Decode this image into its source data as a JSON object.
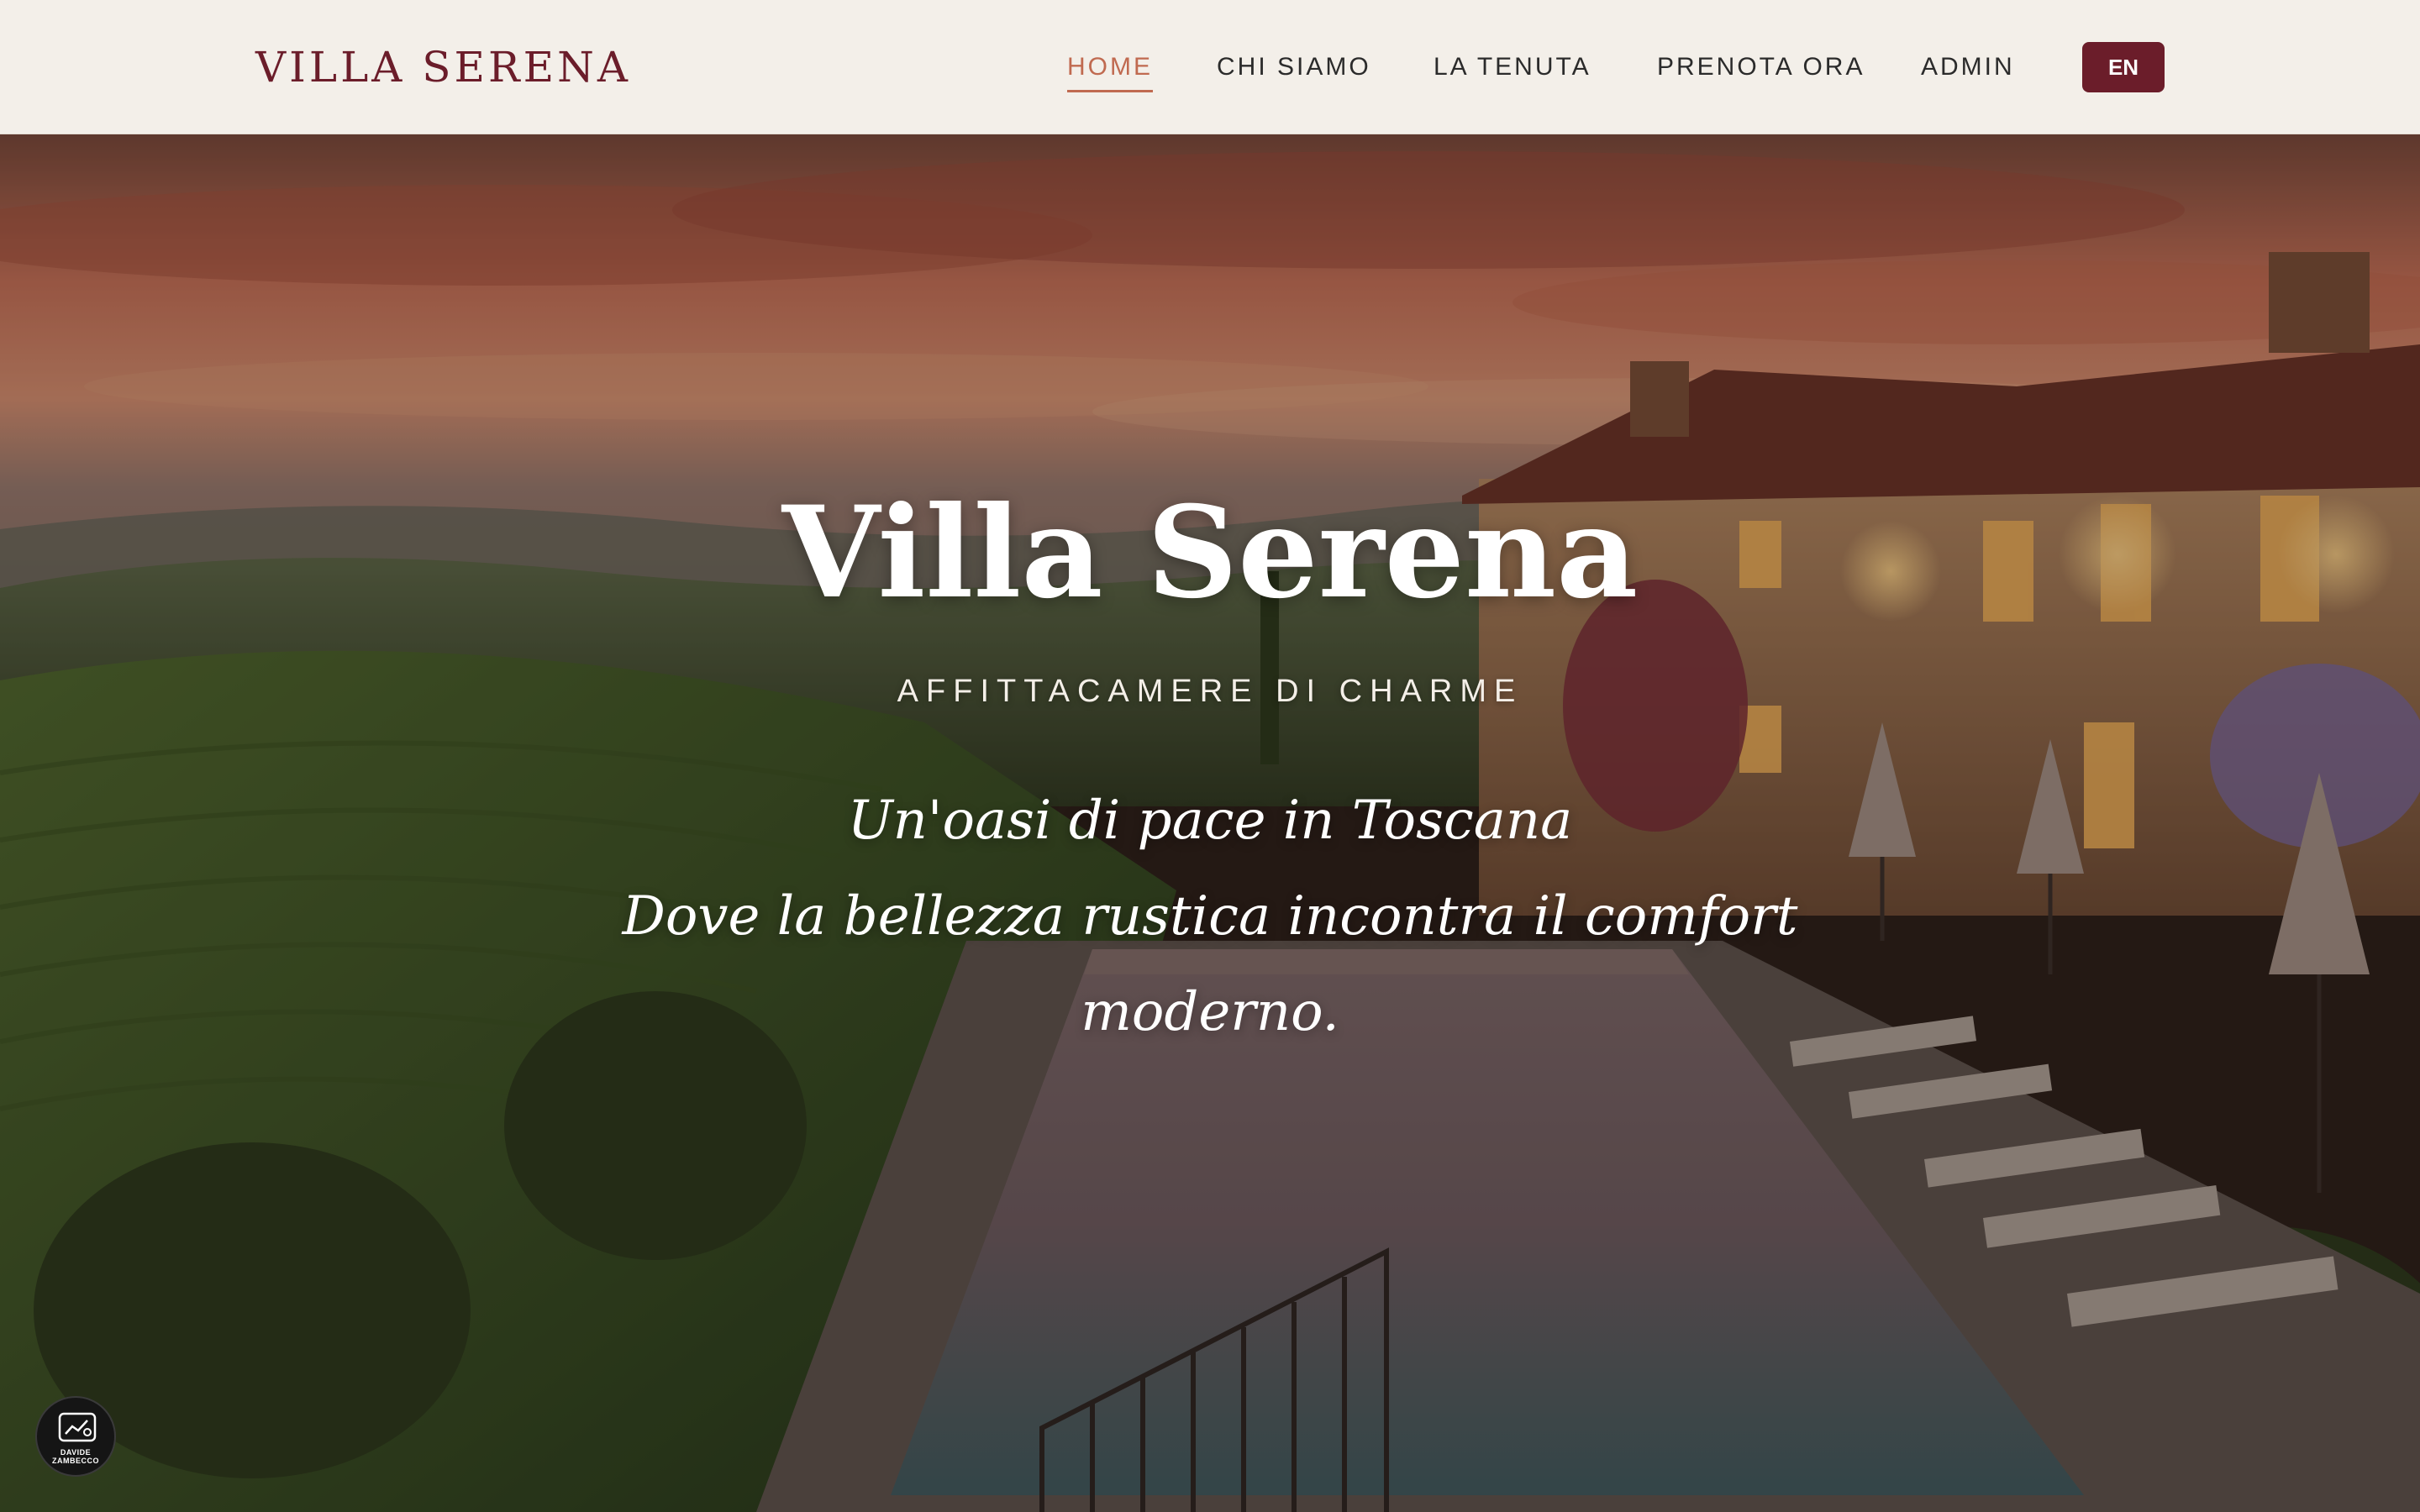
{
  "header": {
    "brand": "VILLA SERENA",
    "nav": {
      "home": "HOME",
      "about": "CHI SIAMO",
      "estate": "LA TENUTA",
      "book": "PRENOTA ORA",
      "admin": "ADMIN"
    },
    "active_item": "home",
    "language_button": "EN"
  },
  "hero": {
    "title": "Villa Serena",
    "subtitle": "AFFITTACAMERE DI CHARME",
    "tagline_line1": "Un'oasi di pace in Toscana",
    "tagline_line2": "Dove la bellezza rustica incontra il comfort moderno."
  },
  "badge": {
    "line1": "DAVIDE",
    "line2": "ZAMBECCO",
    "icon": "chart-icon"
  },
  "colors": {
    "header_bg": "#f3efe9",
    "brand": "#6b1d2a",
    "nav_active": "#c06a50",
    "nav_text": "#2b2b2b",
    "button_bg": "#6b1d2a",
    "button_text": "#ffffff"
  }
}
